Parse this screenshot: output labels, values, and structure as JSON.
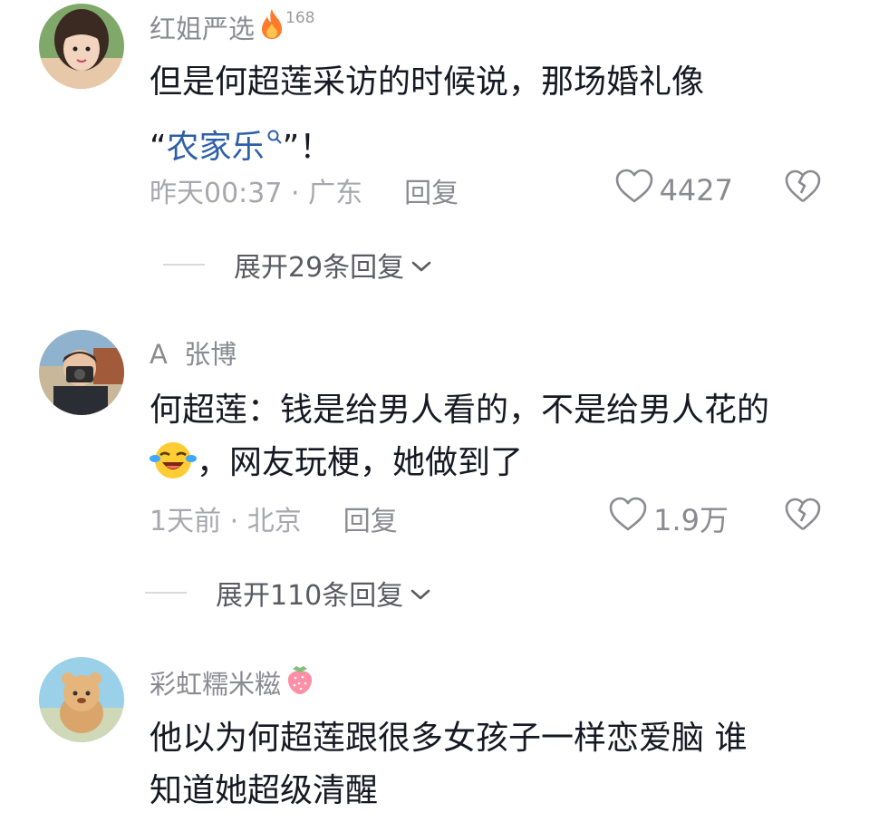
{
  "comments": [
    {
      "username": "红姐严选",
      "fire_count": "168",
      "text_line1": "但是何超莲采访的时候说，那场婚礼像",
      "quote_open": "“",
      "link_text": "农家乐",
      "quote_close": "”！",
      "time_location": "昨天00:37 · 广东",
      "reply_label": "回复",
      "likes": "4427",
      "expand_label": "展开29条回复"
    },
    {
      "username": "A  张博",
      "text_line1": "何超莲：钱是给男人看的，不是给男人花的",
      "text_line2": "，网友玩梗，她做到了",
      "time_location": "1天前 · 北京",
      "reply_label": "回复",
      "likes": "1.9万",
      "expand_label": "展开110条回复"
    },
    {
      "username": "彩虹糯米糍",
      "text_line1": "他以为何超莲跟很多女孩子一样恋爱脑 谁",
      "text_line2": "知道她超级清醒"
    }
  ],
  "icons": {
    "fire": "fire-icon",
    "search": "search-icon",
    "heart": "heart-icon",
    "broken_heart": "broken-heart-icon",
    "chevron": "chevron-down-icon",
    "laugh_emoji": "laughing-crying-emoji",
    "strawberry": "strawberry-icon"
  },
  "colors": {
    "text": "#161823",
    "muted": "#8a8b91",
    "link": "#2f5fa8"
  }
}
